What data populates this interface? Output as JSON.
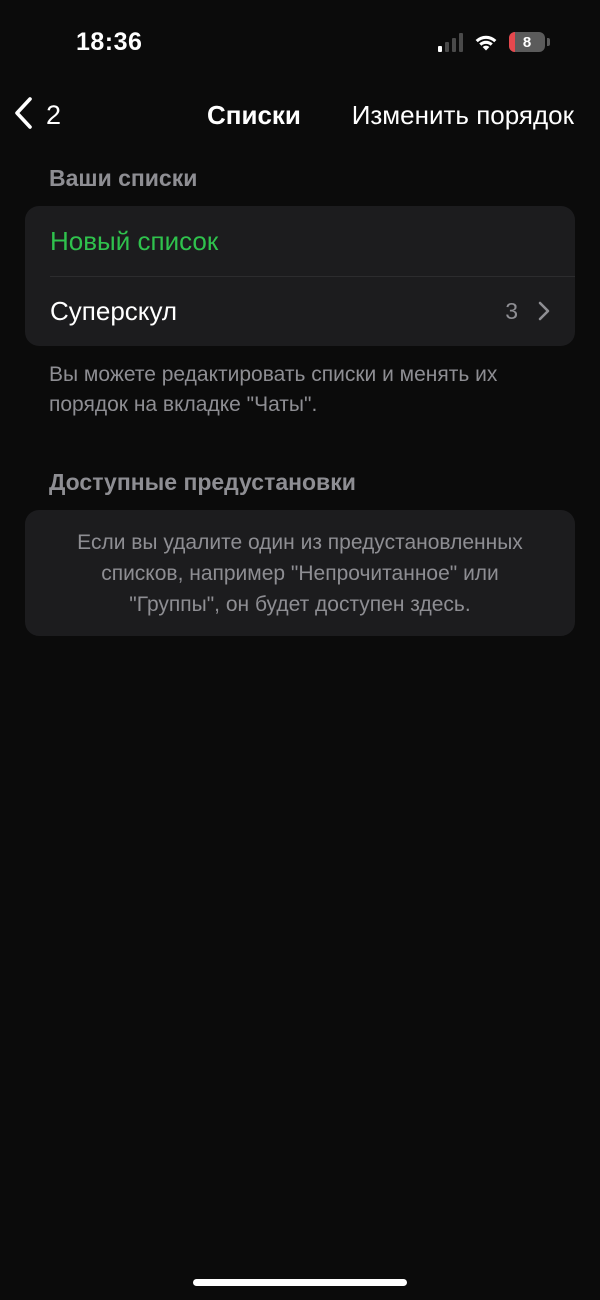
{
  "status_bar": {
    "time": "18:36",
    "battery_level": "8",
    "signal_bars_active": 1,
    "signal_bars_total": 4
  },
  "nav": {
    "back_count": "2",
    "title": "Списки",
    "action": "Изменить порядок"
  },
  "your_lists": {
    "header": "Ваши списки",
    "new_list": "Новый список",
    "items": [
      {
        "label": "Суперскул",
        "count": "3"
      }
    ],
    "footnote": "Вы можете редактировать списки и менять их порядок на вкладке \"Чаты\"."
  },
  "presets": {
    "header": "Доступные предустановки",
    "info": "Если вы удалите один из предустановленных\nсписков, например \"Непрочитанное\" или\n\"Группы\", он будет доступен здесь."
  },
  "colors": {
    "accent": "#2fc24d",
    "background": "#0b0b0b",
    "card": "#1c1c1e",
    "secondary_text": "#8e8e93",
    "battery_low": "#e5484d"
  }
}
